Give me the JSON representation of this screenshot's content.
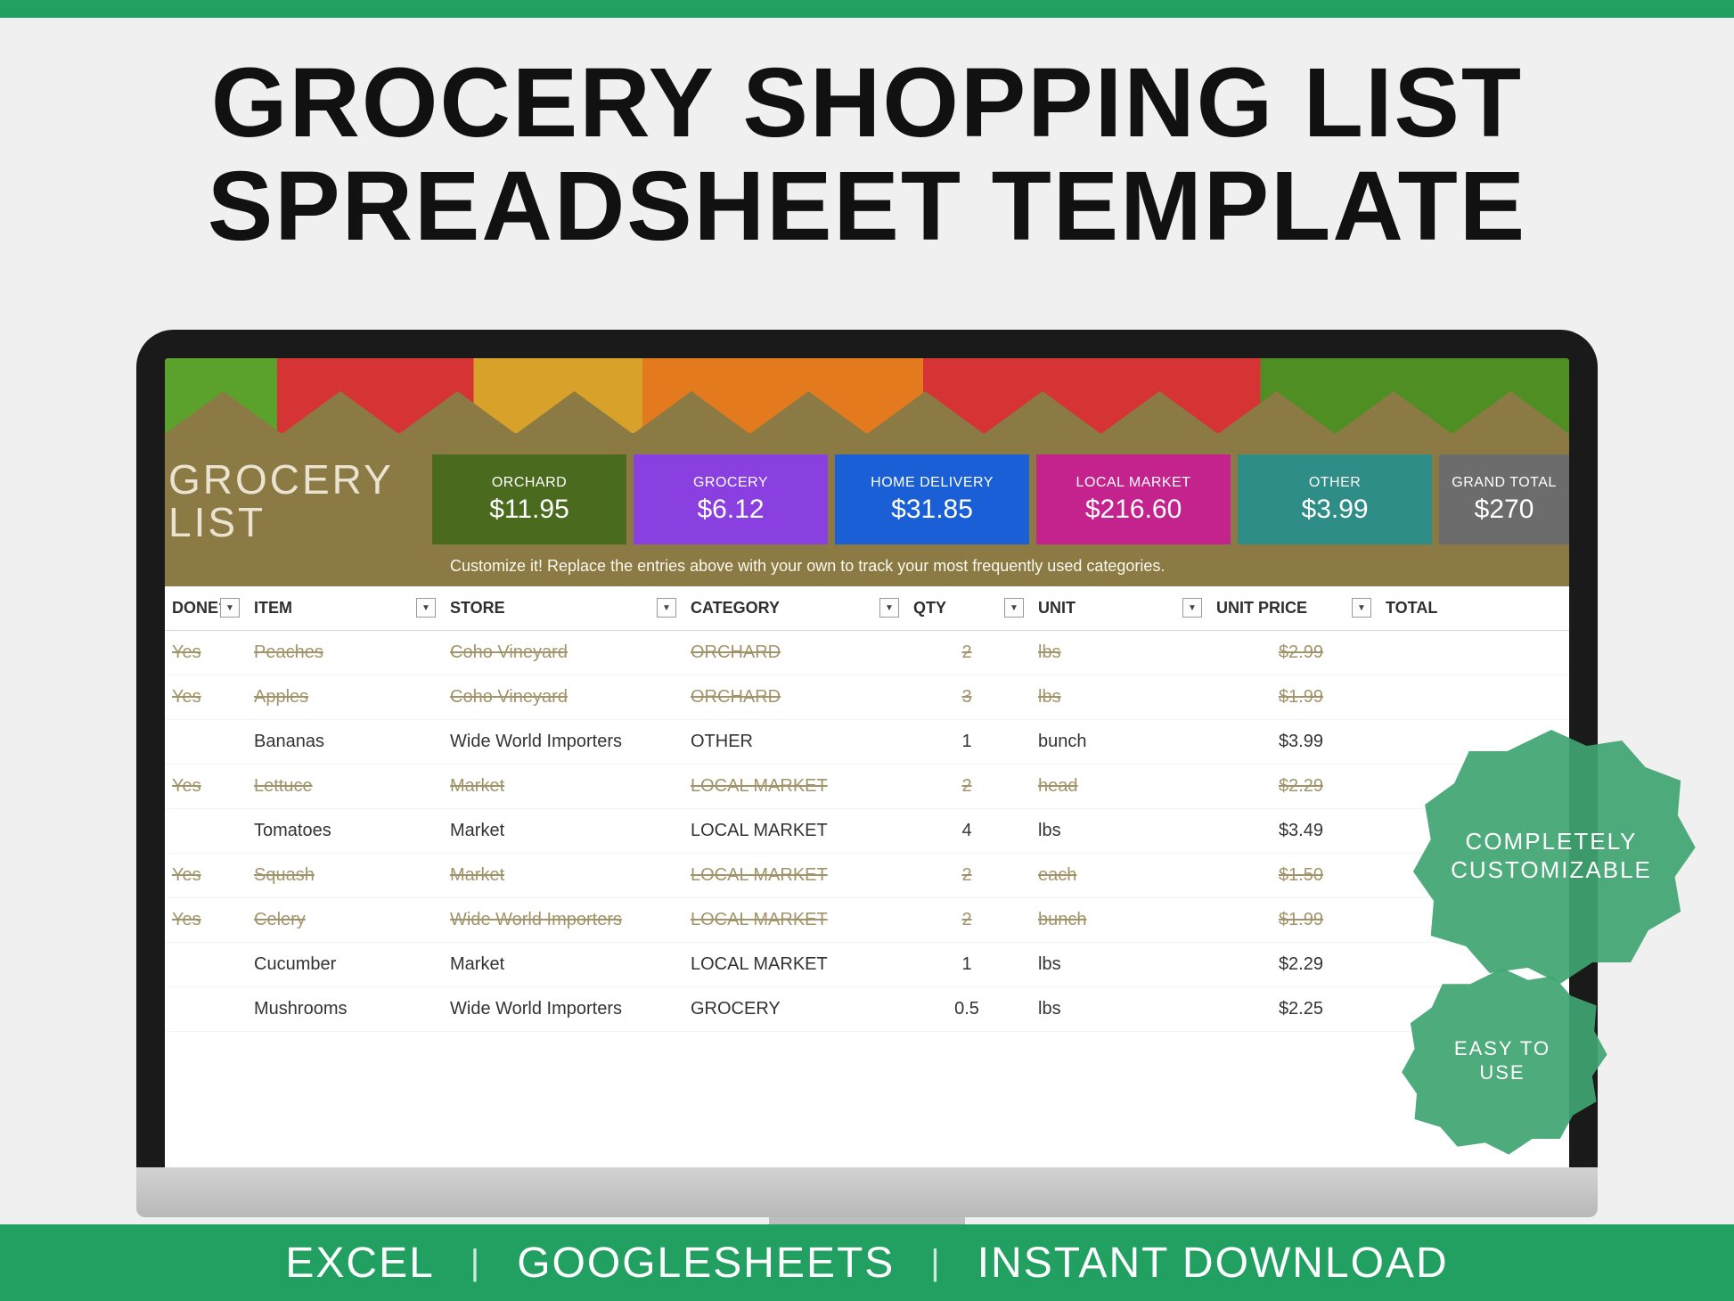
{
  "headline_line1": "GROCERY SHOPPING LIST",
  "headline_line2": "SPREADSHEET TEMPLATE",
  "sheet_title_line1": "GROCERY",
  "sheet_title_line2": "LIST",
  "hint": "Customize it! Replace the entries above with your own to track your most frequently used categories.",
  "categories": [
    {
      "label": "ORCHARD",
      "amount": "$11.95",
      "bg": "#4a6b1e"
    },
    {
      "label": "GROCERY",
      "amount": "$6.12",
      "bg": "#8a3fe0"
    },
    {
      "label": "HOME DELIVERY",
      "amount": "$31.85",
      "bg": "#1a5fd6"
    },
    {
      "label": "LOCAL MARKET",
      "amount": "$216.60",
      "bg": "#c4238e"
    },
    {
      "label": "OTHER",
      "amount": "$3.99",
      "bg": "#2f8d87"
    },
    {
      "label": "GRAND TOTAL",
      "amount": "$270",
      "bg": "#6c6c6c"
    }
  ],
  "columns": [
    "DONE?",
    "ITEM",
    "STORE",
    "CATEGORY",
    "QTY",
    "UNIT",
    "UNIT PRICE",
    "TOTAL"
  ],
  "rows": [
    {
      "done": "Yes",
      "item": "Peaches",
      "store": "Coho Vineyard",
      "category": "ORCHARD",
      "qty": "2",
      "unit": "lbs",
      "price": "$2.99",
      "struck": true
    },
    {
      "done": "Yes",
      "item": "Apples",
      "store": "Coho Vineyard",
      "category": "ORCHARD",
      "qty": "3",
      "unit": "lbs",
      "price": "$1.99",
      "struck": true
    },
    {
      "done": "",
      "item": "Bananas",
      "store": "Wide World Importers",
      "category": "OTHER",
      "qty": "1",
      "unit": "bunch",
      "price": "$3.99",
      "struck": false
    },
    {
      "done": "Yes",
      "item": "Lettuce",
      "store": "Market",
      "category": "LOCAL MARKET",
      "qty": "2",
      "unit": "head",
      "price": "$2.29",
      "struck": true
    },
    {
      "done": "",
      "item": "Tomatoes",
      "store": "Market",
      "category": "LOCAL MARKET",
      "qty": "4",
      "unit": "lbs",
      "price": "$3.49",
      "struck": false
    },
    {
      "done": "Yes",
      "item": "Squash",
      "store": "Market",
      "category": "LOCAL MARKET",
      "qty": "2",
      "unit": "each",
      "price": "$1.50",
      "struck": true
    },
    {
      "done": "Yes",
      "item": "Celery",
      "store": "Wide World Importers",
      "category": "LOCAL MARKET",
      "qty": "2",
      "unit": "bunch",
      "price": "$1.99",
      "struck": true
    },
    {
      "done": "",
      "item": "Cucumber",
      "store": "Market",
      "category": "LOCAL MARKET",
      "qty": "1",
      "unit": "lbs",
      "price": "$2.29",
      "struck": false
    },
    {
      "done": "",
      "item": "Mushrooms",
      "store": "Wide World Importers",
      "category": "GROCERY",
      "qty": "0.5",
      "unit": "lbs",
      "price": "$2.25",
      "struck": false
    }
  ],
  "badge1_line1": "COMPLETELY",
  "badge1_line2": "CUSTOMIZABLE",
  "badge2_line1": "EASY TO",
  "badge2_line2": "USE",
  "footer": {
    "a": "EXCEL",
    "b": "GOOGLESHEETS",
    "c": "INSTANT DOWNLOAD"
  }
}
